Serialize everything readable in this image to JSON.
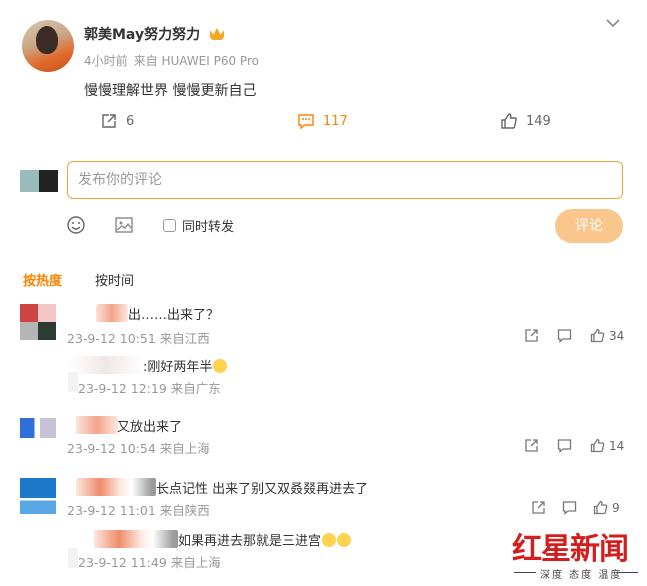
{
  "post": {
    "username": "郭美May努力努力",
    "time": "4小时前",
    "source": "来自 HUAWEI P60 Pro",
    "text": "慢慢理解世界 慢慢更新自己",
    "reposts": "6",
    "comments": "117",
    "likes": "149"
  },
  "compose": {
    "placeholder": "发布你的评论",
    "repost_label": "同时转发",
    "submit_label": "评论"
  },
  "sort": {
    "hot": "按热度",
    "time": "按时间"
  },
  "comments": [
    {
      "text": "出……出来了？",
      "meta": "23-9-12 10:51 来自江西",
      "likes": "34"
    },
    {
      "text": ":刚好两年半",
      "meta": "23-9-12 12:19 来自广东"
    },
    {
      "text": "又放出来了",
      "meta": "23-9-12 10:54 来自上海",
      "likes": "14"
    },
    {
      "text": "长点记性 出来了别又双叒叕再进去了",
      "meta": "23-9-12 11:01 来自陕西",
      "likes": "9"
    },
    {
      "text": "如果再进去那就是三进宫",
      "meta": "23-9-12 11:49 来自上海"
    }
  ],
  "watermark": {
    "main": "红星新闻",
    "sub": "深度 态度 温度"
  },
  "colors": {
    "accent": "#ff8200",
    "input_border": "#f6a53a",
    "button": "#fbc68b",
    "watermark": "#d41e1e"
  },
  "icons": [
    "menu-chevron-icon",
    "repost-icon",
    "comment-icon",
    "like-icon",
    "emoji-icon",
    "image-icon",
    "share-icon",
    "reply-icon",
    "crown-icon"
  ]
}
